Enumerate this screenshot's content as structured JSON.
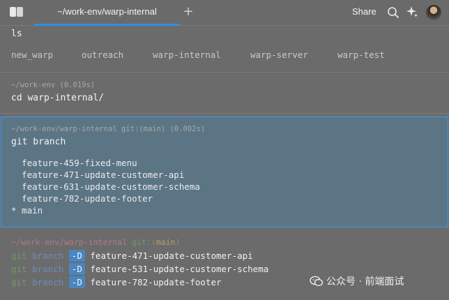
{
  "topbar": {
    "tab_title": "~/work-env/warp-internal",
    "share_label": "Share",
    "icons": [
      "panels-icon",
      "plus-icon",
      "search-icon",
      "sparkle-icon",
      "avatar"
    ]
  },
  "blocks": {
    "ls": {
      "command": "ls",
      "outputs": [
        "new_warp",
        "outreach",
        "warp-internal",
        "warp-server",
        "warp-test"
      ]
    },
    "cd": {
      "meta": "~/work-env (0.019s)",
      "command": "cd warp-internal/"
    },
    "git_branch": {
      "meta": "~/work-env/warp-internal git:(main) (0.002s)",
      "command": "git branch",
      "branches": [
        "  feature-459-fixed-menu",
        "  feature-471-update-customer-api",
        "  feature-631-update-customer-schema",
        "  feature-782-update-footer",
        "* main"
      ]
    },
    "input": {
      "prompt_path": "~/work-env/warp-internal",
      "prompt_git": "git:(",
      "prompt_branch": "main",
      "prompt_close": ")",
      "commands": [
        {
          "git": "git",
          "sub": "branch",
          "flag": "-D",
          "name": "feature-471-update-customer-api"
        },
        {
          "git": "git",
          "sub": "branch",
          "flag": "-D",
          "name": "feature-531-update-customer-schema"
        },
        {
          "git": "git",
          "sub": "branch",
          "flag": "-D",
          "name": "feature-782-update-footer"
        }
      ]
    }
  },
  "watermark": "公众号 · 前端面试",
  "colors": {
    "accent": "#3f97e6",
    "selected_block_bg": "#5c7585",
    "background": "#6b6b6b"
  }
}
